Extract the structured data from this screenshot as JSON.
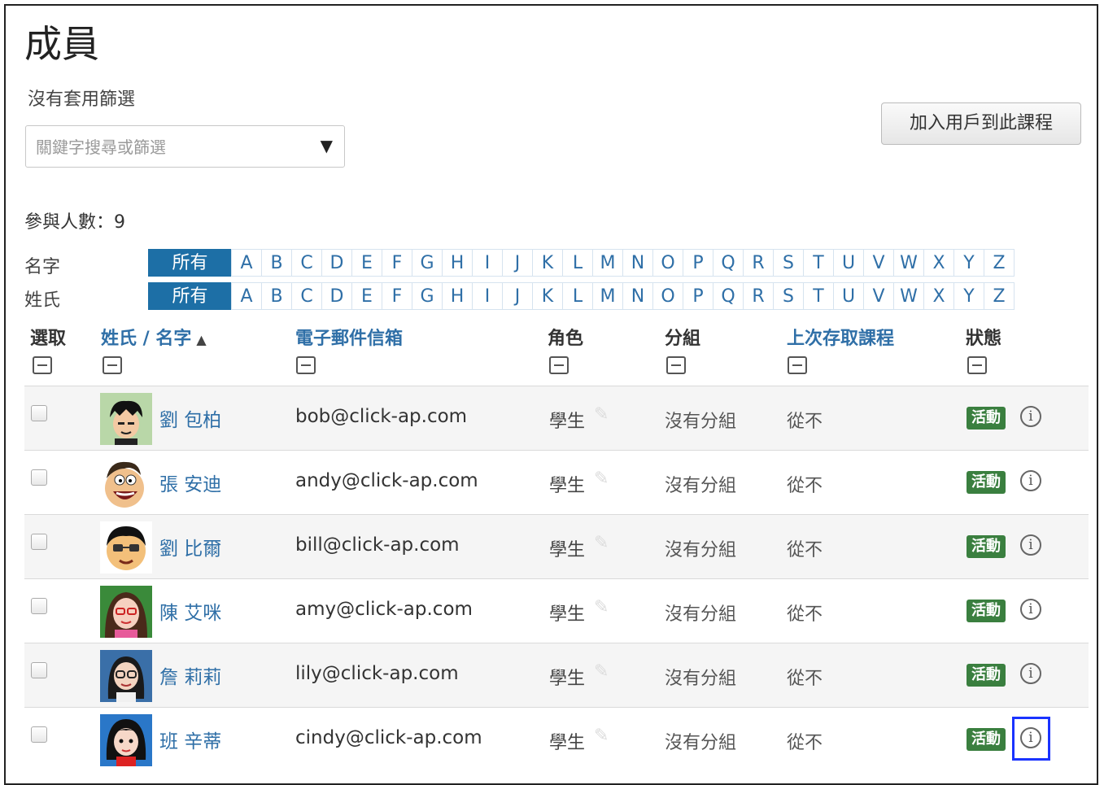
{
  "page": {
    "title": "成員",
    "no_filter_text": "沒有套用篩選",
    "filter_placeholder": "關鍵字搜尋或篩選",
    "enrol_button": "加入用戶到此課程",
    "participants_count": "參與人數：9"
  },
  "initials_bar": {
    "firstname_label": "名字",
    "lastname_label": "姓氏",
    "all_label": "所有",
    "letters": [
      "A",
      "B",
      "C",
      "D",
      "E",
      "F",
      "G",
      "H",
      "I",
      "J",
      "K",
      "L",
      "M",
      "N",
      "O",
      "P",
      "Q",
      "R",
      "S",
      "T",
      "U",
      "V",
      "W",
      "X",
      "Y",
      "Z"
    ]
  },
  "table": {
    "headers": {
      "select": "選取",
      "name": "姓氏 / 名字",
      "email": "電子郵件信箱",
      "role": "角色",
      "group": "分組",
      "last_access": "上次存取課程",
      "status": "狀態"
    },
    "rows": [
      {
        "name": "劉 包柏",
        "email": "bob@click-ap.com",
        "role": "學生",
        "group": "沒有分組",
        "last_access": "從不",
        "status": "活動",
        "avatar": "avatar-bob"
      },
      {
        "name": "張 安迪",
        "email": "andy@click-ap.com",
        "role": "學生",
        "group": "沒有分組",
        "last_access": "從不",
        "status": "活動",
        "avatar": "avatar-andy"
      },
      {
        "name": "劉 比爾",
        "email": "bill@click-ap.com",
        "role": "學生",
        "group": "沒有分組",
        "last_access": "從不",
        "status": "活動",
        "avatar": "avatar-bill"
      },
      {
        "name": "陳 艾咪",
        "email": "amy@click-ap.com",
        "role": "學生",
        "group": "沒有分組",
        "last_access": "從不",
        "status": "活動",
        "avatar": "avatar-amy"
      },
      {
        "name": "詹 莉莉",
        "email": "lily@click-ap.com",
        "role": "學生",
        "group": "沒有分組",
        "last_access": "從不",
        "status": "活動",
        "avatar": "avatar-lily"
      },
      {
        "name": "班 辛蒂",
        "email": "cindy@click-ap.com",
        "role": "學生",
        "group": "沒有分組",
        "last_access": "從不",
        "status": "活動",
        "avatar": "avatar-cindy"
      }
    ]
  },
  "colors": {
    "link": "#2f6fa7",
    "initial_active": "#1d6fa6",
    "badge_active": "#3a7f3f",
    "highlight_box": "#1a33ff"
  },
  "icons": {
    "dropdown": "dropdown-arrow-icon",
    "collapse": "collapse-column-icon",
    "edit": "pencil-icon",
    "info": "info-icon",
    "sort": "sort-asc-icon"
  }
}
